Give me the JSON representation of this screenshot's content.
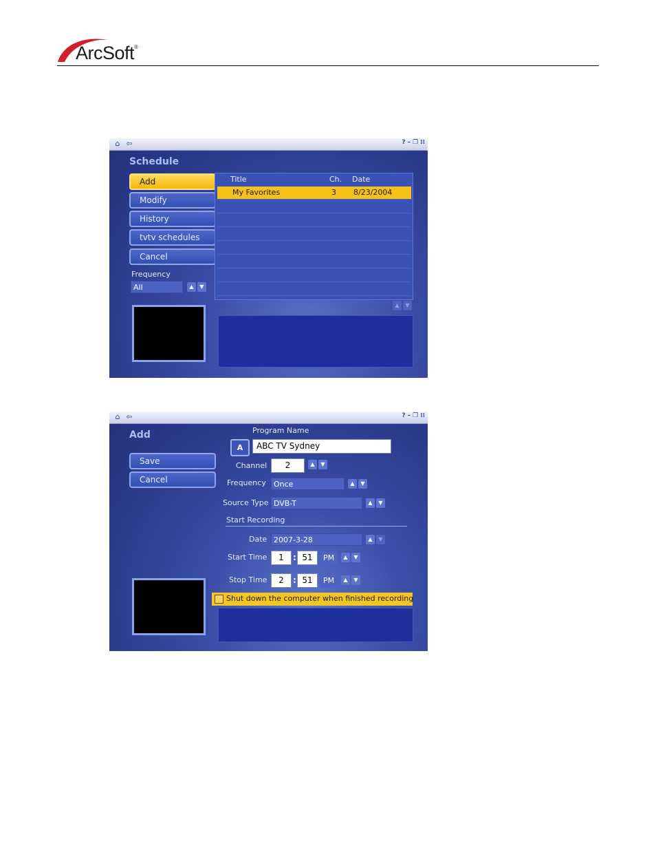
{
  "header": {
    "logo_text": "ArcSoft",
    "logo_reg": "®"
  },
  "icons": {
    "home": "home-icon",
    "back": "back-arrow-icon",
    "help": "help-icon",
    "minimize": "minimize-icon",
    "restore": "restore-icon",
    "close": "close-icon"
  },
  "schedule": {
    "title": "Schedule",
    "buttons": [
      "Add",
      "Modify",
      "History",
      "tvtv schedules",
      "Cancel"
    ],
    "frequency_label": "Frequency",
    "frequency_value": "All",
    "list": {
      "headers": [
        "Title",
        "Ch.",
        "Date"
      ],
      "rows": [
        {
          "title": "My Favorites",
          "ch": "3",
          "date": "8/23/2004"
        }
      ]
    }
  },
  "add": {
    "title": "Add",
    "save_label": "Save",
    "cancel_label": "Cancel",
    "program_name_label": "Program Name",
    "program_name_value": "ABC TV Sydney",
    "program_name_icon": "A",
    "channel_label": "Channel",
    "channel_value": "2",
    "frequency_label": "Frequency",
    "frequency_value": "Once",
    "source_type_label": "Source Type",
    "source_type_value": "DVB-T",
    "start_recording_label": "Start Recording",
    "date_label": "Date",
    "date_value": "2007-3-28",
    "start_time_label": "Start Time",
    "start_hour": "1",
    "start_min": "51",
    "start_ampm": "PM",
    "stop_time_label": "Stop Time",
    "stop_hour": "2",
    "stop_min": "51",
    "stop_ampm": "PM",
    "shutdown_label": "Shut down the computer when finished recording"
  },
  "colors": {
    "accent": "#f6c21a",
    "panel": "#3b4fa9",
    "info": "#1c2f9a"
  }
}
